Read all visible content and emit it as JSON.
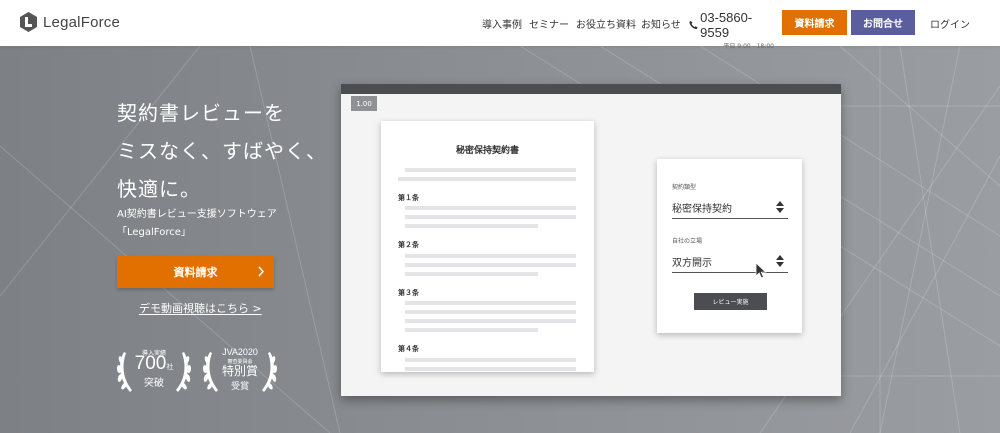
{
  "header": {
    "logo_text": "LegalForce",
    "nav": [
      "導入事例",
      "セミナー",
      "お役立ち資料",
      "お知らせ"
    ],
    "phone": "03-5860-9559",
    "phone_hours": "平日 9:00 - 18:00",
    "docs_button": "資料請求",
    "contact_button": "お問合せ",
    "login": "ログイン"
  },
  "hero": {
    "title_lines": [
      "契約書レビューを",
      "ミスなく、すばやく、",
      "快適に。"
    ],
    "sub_lines": [
      "AI契約書レビュー支援ソフトウェア",
      "「LegalForce」"
    ],
    "cta": "資料請求",
    "demo_link": "デモ動画視聴はこちら >",
    "badge1": {
      "top": "導入実績",
      "num": "700",
      "unit": "社",
      "bottom": "突破"
    },
    "badge2": {
      "top": "JVA2020",
      "mid": "審査委員会",
      "main": "特別賞",
      "bottom": "受賞"
    }
  },
  "window": {
    "zoom": "1.00",
    "doc_title": "秘密保持契約書",
    "articles": [
      "第１条",
      "第２条",
      "第３条",
      "第４条"
    ],
    "panel": {
      "type_label": "契約類型",
      "type_value": "秘密保持契約",
      "position_label": "自社の立場",
      "position_value": "双方開示",
      "review_button": "レビュー実施"
    }
  },
  "colors": {
    "orange": "#e17000",
    "purple": "#5b5e9c",
    "dark": "#4b4d51"
  }
}
